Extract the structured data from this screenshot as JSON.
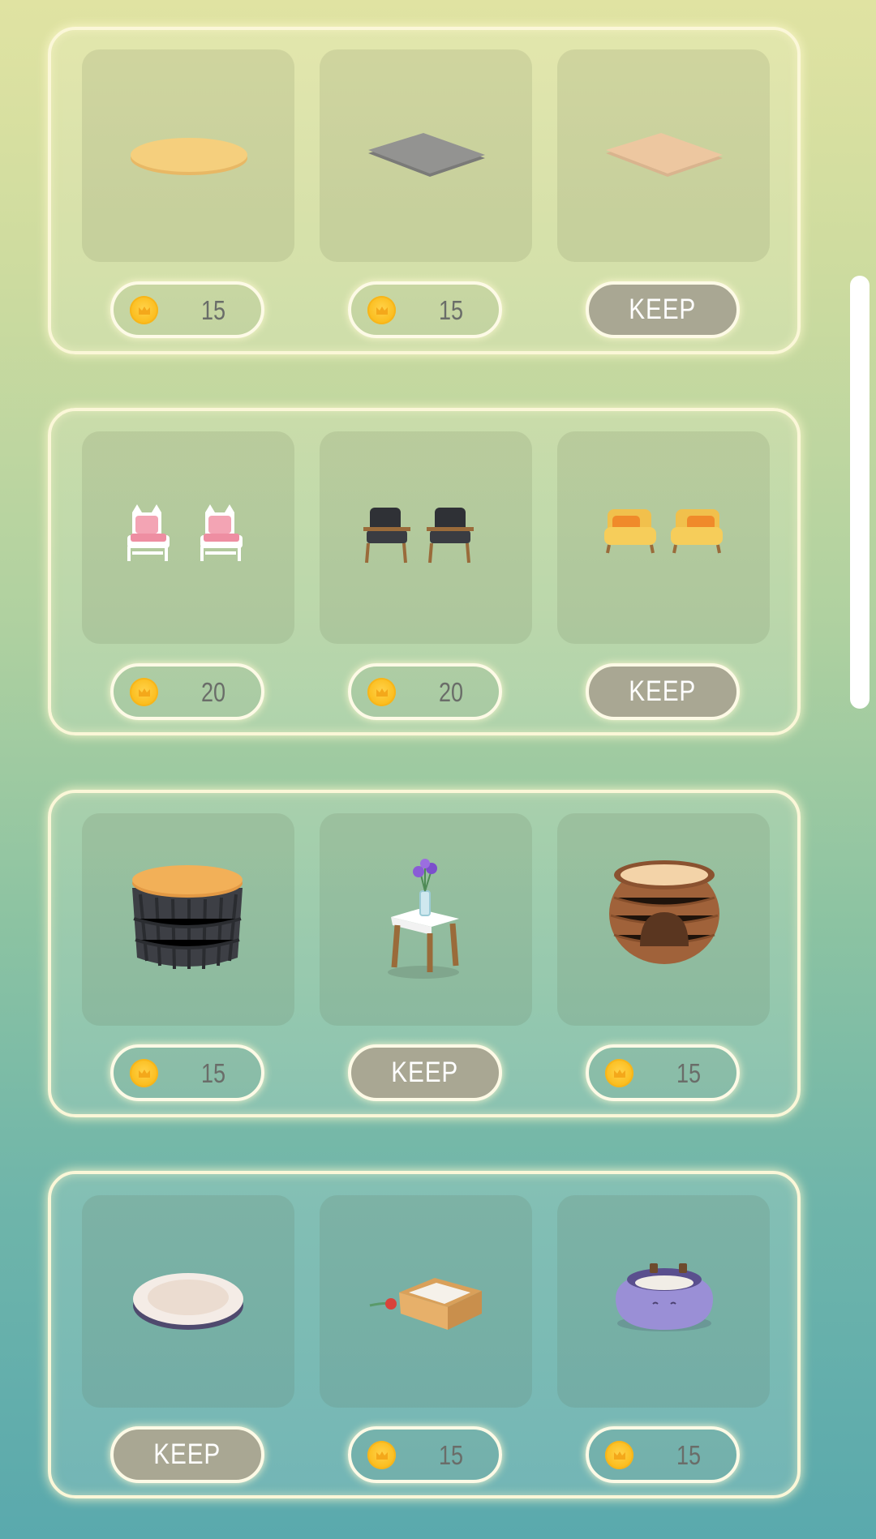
{
  "colors": {
    "panel_border": "#fbf7d8",
    "coin": "#fbbd1e",
    "keep_button": "#a9a793",
    "price_text": "#6a6d69"
  },
  "rows": [
    {
      "items": [
        {
          "name": "round-yellow-rug",
          "kind": "price",
          "amount": "15"
        },
        {
          "name": "gray-rug",
          "kind": "price",
          "amount": "15"
        },
        {
          "name": "peach-rug",
          "kind": "keep",
          "label": "KEEP"
        }
      ]
    },
    {
      "items": [
        {
          "name": "pink-cat-chairs",
          "kind": "price",
          "amount": "20"
        },
        {
          "name": "black-leather-chairs",
          "kind": "price",
          "amount": "20"
        },
        {
          "name": "yellow-armchairs",
          "kind": "keep",
          "label": "KEEP"
        }
      ]
    },
    {
      "items": [
        {
          "name": "woven-side-table",
          "kind": "price",
          "amount": "15"
        },
        {
          "name": "flower-vase-table",
          "kind": "keep",
          "label": "KEEP"
        },
        {
          "name": "wicker-cat-house",
          "kind": "price",
          "amount": "15"
        }
      ]
    },
    {
      "items": [
        {
          "name": "round-cushion-bed",
          "kind": "keep",
          "label": "KEEP"
        },
        {
          "name": "cardboard-box-toy",
          "kind": "price",
          "amount": "15"
        },
        {
          "name": "purple-cat-bed",
          "kind": "price",
          "amount": "15"
        }
      ]
    }
  ]
}
